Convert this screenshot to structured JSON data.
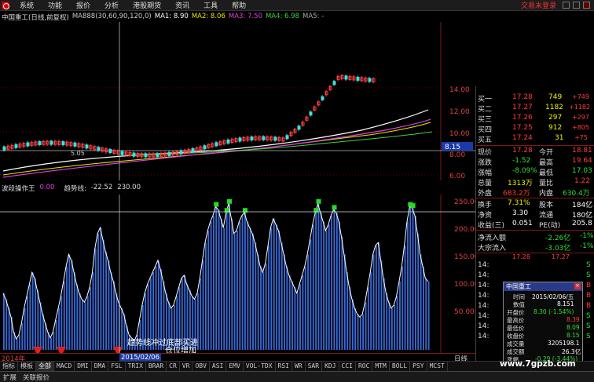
{
  "menu": {
    "items": [
      "系统",
      "功能",
      "报价",
      "分析",
      "港股期货",
      "资讯",
      "工具",
      "帮助"
    ],
    "trade_status": "交易未登录"
  },
  "main_chart": {
    "title": "中国重工(日线,前复权)",
    "ma_param": "MA888(30,60,90,120,0)",
    "ma1": "MA1: 8.90",
    "ma2": "MA2: 8.06",
    "ma3": "MA3: 7.50",
    "ma4": "MA4: 6.98",
    "ma5": "MA5: -",
    "price_axis": [
      "14.00",
      "12.00",
      "10.00",
      "8.00",
      "6.00"
    ],
    "low_label": "5.05",
    "crosshair_value": "8.15"
  },
  "indicator": {
    "name": "波段操作王",
    "name_value": "0.00",
    "trend_label": "趋势线:",
    "trend_value": "-22.52",
    "trend_value2": "230.00",
    "axis": [
      "250.00",
      "200.00",
      "150.00",
      "100.00",
      "50.00"
    ],
    "annotation_line1": "趋势线冲过底部买进",
    "annotation_line2": "仓位增加"
  },
  "chart_data": {
    "type": "bar",
    "title": "波段操作王",
    "ylim": [
      0,
      250
    ],
    "threshold": 230,
    "values": [
      95,
      85,
      70,
      55,
      30,
      18,
      25,
      45,
      70,
      90,
      110,
      130,
      120,
      100,
      80,
      60,
      45,
      30,
      20,
      30,
      50,
      70,
      90,
      115,
      140,
      160,
      150,
      130,
      110,
      95,
      85,
      80,
      90,
      105,
      130,
      170,
      195,
      205,
      185,
      165,
      150,
      130,
      115,
      95,
      80,
      70,
      60,
      40,
      25,
      20,
      15,
      25,
      50,
      75,
      95,
      110,
      120,
      130,
      140,
      150,
      135,
      115,
      95,
      80,
      70,
      75,
      90,
      105,
      120,
      125,
      110,
      100,
      90,
      85,
      95,
      120,
      150,
      180,
      200,
      215,
      225,
      240,
      235,
      220,
      205,
      230,
      245,
      220,
      195,
      200,
      215,
      225,
      230,
      215,
      205,
      195,
      180,
      160,
      140,
      130,
      145,
      175,
      205,
      220,
      210,
      200,
      180,
      160,
      140,
      125,
      115,
      105,
      95,
      110,
      125,
      140,
      160,
      185,
      210,
      230,
      245,
      230,
      215,
      200,
      210,
      225,
      235,
      230,
      215,
      190,
      160,
      130,
      105,
      85,
      70,
      60,
      55,
      60,
      80,
      105,
      130,
      160,
      175,
      180,
      150,
      120,
      95,
      80,
      70,
      75,
      90,
      115,
      140,
      175,
      215,
      240,
      238,
      225,
      195,
      160,
      140,
      120,
      115
    ]
  },
  "right_panel": {
    "bids": [
      {
        "label": "买一",
        "price": "17.28",
        "vol": "749",
        "chg": "+749"
      },
      {
        "label": "买二",
        "price": "17.27",
        "vol": "1182",
        "chg": "+1182"
      },
      {
        "label": "买三",
        "price": "17.26",
        "vol": "297",
        "chg": "+297"
      },
      {
        "label": "买四",
        "price": "17.25",
        "vol": "912",
        "chg": "+805"
      },
      {
        "label": "买五",
        "price": "17.24",
        "vol": "31",
        "chg": "+75"
      }
    ],
    "stats": [
      {
        "l1": "现价",
        "v1": "17.28",
        "l2": "今开",
        "v2": "18.81"
      },
      {
        "l1": "涨跌",
        "v1": "-1.52",
        "l2": "最高",
        "v2": "19.64"
      },
      {
        "l1": "涨幅",
        "v1": "-8.09%",
        "l2": "最低",
        "v2": "17.03"
      },
      {
        "l1": "总量",
        "v1": "1313万",
        "l2": "量比",
        "v2": "1.22"
      },
      {
        "l1": "外盘",
        "v1": "683.2万",
        "l2": "内盘",
        "v2": "630.4万"
      },
      {
        "l1": "换手",
        "v1": "7.31%",
        "l2": "股本",
        "v2": "184亿"
      },
      {
        "l1": "净资",
        "v1": "3.30",
        "l2": "流通",
        "v2": "180亿"
      },
      {
        "l1": "收益(三)",
        "v1": "0.051",
        "l2": "PE(动)",
        "v2": "205.8"
      }
    ],
    "flows": [
      {
        "label": "净流入额",
        "value": "-2.26亿",
        "pct": "-1%"
      },
      {
        "label": "大宗流入",
        "value": "-3.03亿",
        "pct": "-1%"
      }
    ],
    "ticks": [
      "14:",
      "14:",
      "14:",
      "14:",
      "14:",
      "14:",
      "14:",
      "14:"
    ],
    "tick_flags": [
      "S",
      "S",
      "B",
      "B",
      "B",
      "S",
      "S",
      "S"
    ],
    "partial_prices": [
      "17.28",
      "17.27"
    ]
  },
  "popup": {
    "title": "中国重工",
    "rows": [
      {
        "label": "时间",
        "value": "2015/02/06/五"
      },
      {
        "label": "数值",
        "value": "8.151"
      },
      {
        "label": "开盘价",
        "value": "8.30 (-1.54%)"
      },
      {
        "label": "最高价",
        "value": "8.39"
      },
      {
        "label": "最低价",
        "value": "8.09"
      },
      {
        "label": "收盘价",
        "value": "8.15"
      },
      {
        "label": "成交量",
        "value": "3205198.1"
      },
      {
        "label": "成交额",
        "value": "26.3亿"
      },
      {
        "label": "涨幅",
        "value": "-0.29 (-3.44%)"
      }
    ]
  },
  "x_axis": {
    "year": "2014年",
    "crosshair_date": "2015/02/06",
    "period": "日线"
  },
  "tabs": [
    "指标",
    "模板",
    "全部",
    "MACD",
    "DMI",
    "DMA",
    "FSL",
    "TRIX",
    "BRAR",
    "CR",
    "VR",
    "OBV",
    "ASI",
    "EMV",
    "VOL-TDX",
    "RSI",
    "WR",
    "SAR",
    "KDJ",
    "CCI",
    "ROC",
    "MTM",
    "BOLL",
    "PSY",
    "MCST"
  ],
  "status": [
    "扩展",
    "关联报价"
  ],
  "watermark": "www.7gpzb.com"
}
